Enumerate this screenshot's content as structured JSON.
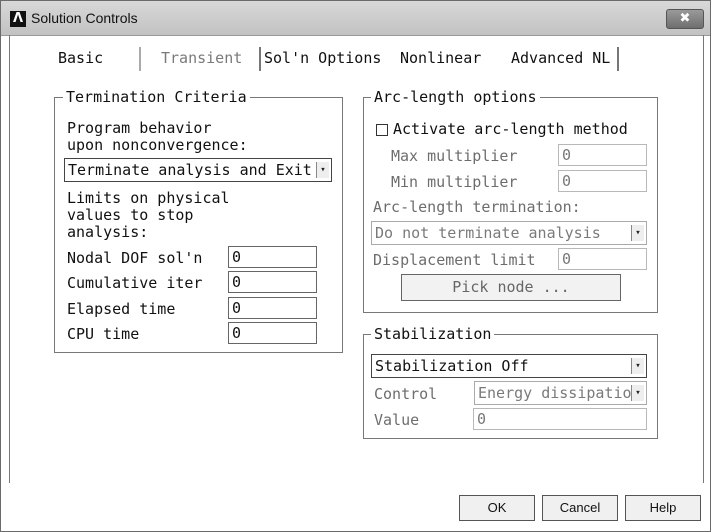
{
  "window": {
    "title": "Solution Controls",
    "app_icon": "Λ",
    "close": "✖"
  },
  "tabs": [
    {
      "label": "Basic"
    },
    {
      "label": "Transient"
    },
    {
      "label": "Sol'n Options"
    },
    {
      "label": "Nonlinear"
    },
    {
      "label": "Advanced NL"
    }
  ],
  "termination": {
    "title": "Termination Criteria",
    "behavior_label_1": "Program behavior",
    "behavior_label_2": "upon nonconvergence:",
    "behavior_value": "Terminate analysis and Exit",
    "limits_label_1": "Limits on physical",
    "limits_label_2": "values to stop",
    "limits_label_3": "analysis:",
    "rows": [
      {
        "label": "Nodal DOF sol'n",
        "value": "0"
      },
      {
        "label": "Cumulative iter",
        "value": "0"
      },
      {
        "label": "Elapsed time",
        "value": "0"
      },
      {
        "label": "CPU time",
        "value": "0"
      }
    ]
  },
  "arc_length": {
    "title": "Arc-length options",
    "activate_label": "Activate arc-length method",
    "max_label": "Max multiplier",
    "max_value": "0",
    "min_label": "Min multiplier",
    "min_value": "0",
    "termination_label": "Arc-length termination:",
    "termination_value": "Do not terminate analysis",
    "displacement_label": "Displacement limit",
    "displacement_value": "0",
    "pick_node_label": "Pick node ..."
  },
  "stabilization": {
    "title": "Stabilization",
    "mode_value": "Stabilization Off",
    "control_label": "Control",
    "control_value": "Energy dissipation",
    "value_label": "Value",
    "value_value": "0"
  },
  "buttons": {
    "ok": "OK",
    "cancel": "Cancel",
    "help": "Help"
  },
  "icons": {
    "dropdown": "▾"
  }
}
